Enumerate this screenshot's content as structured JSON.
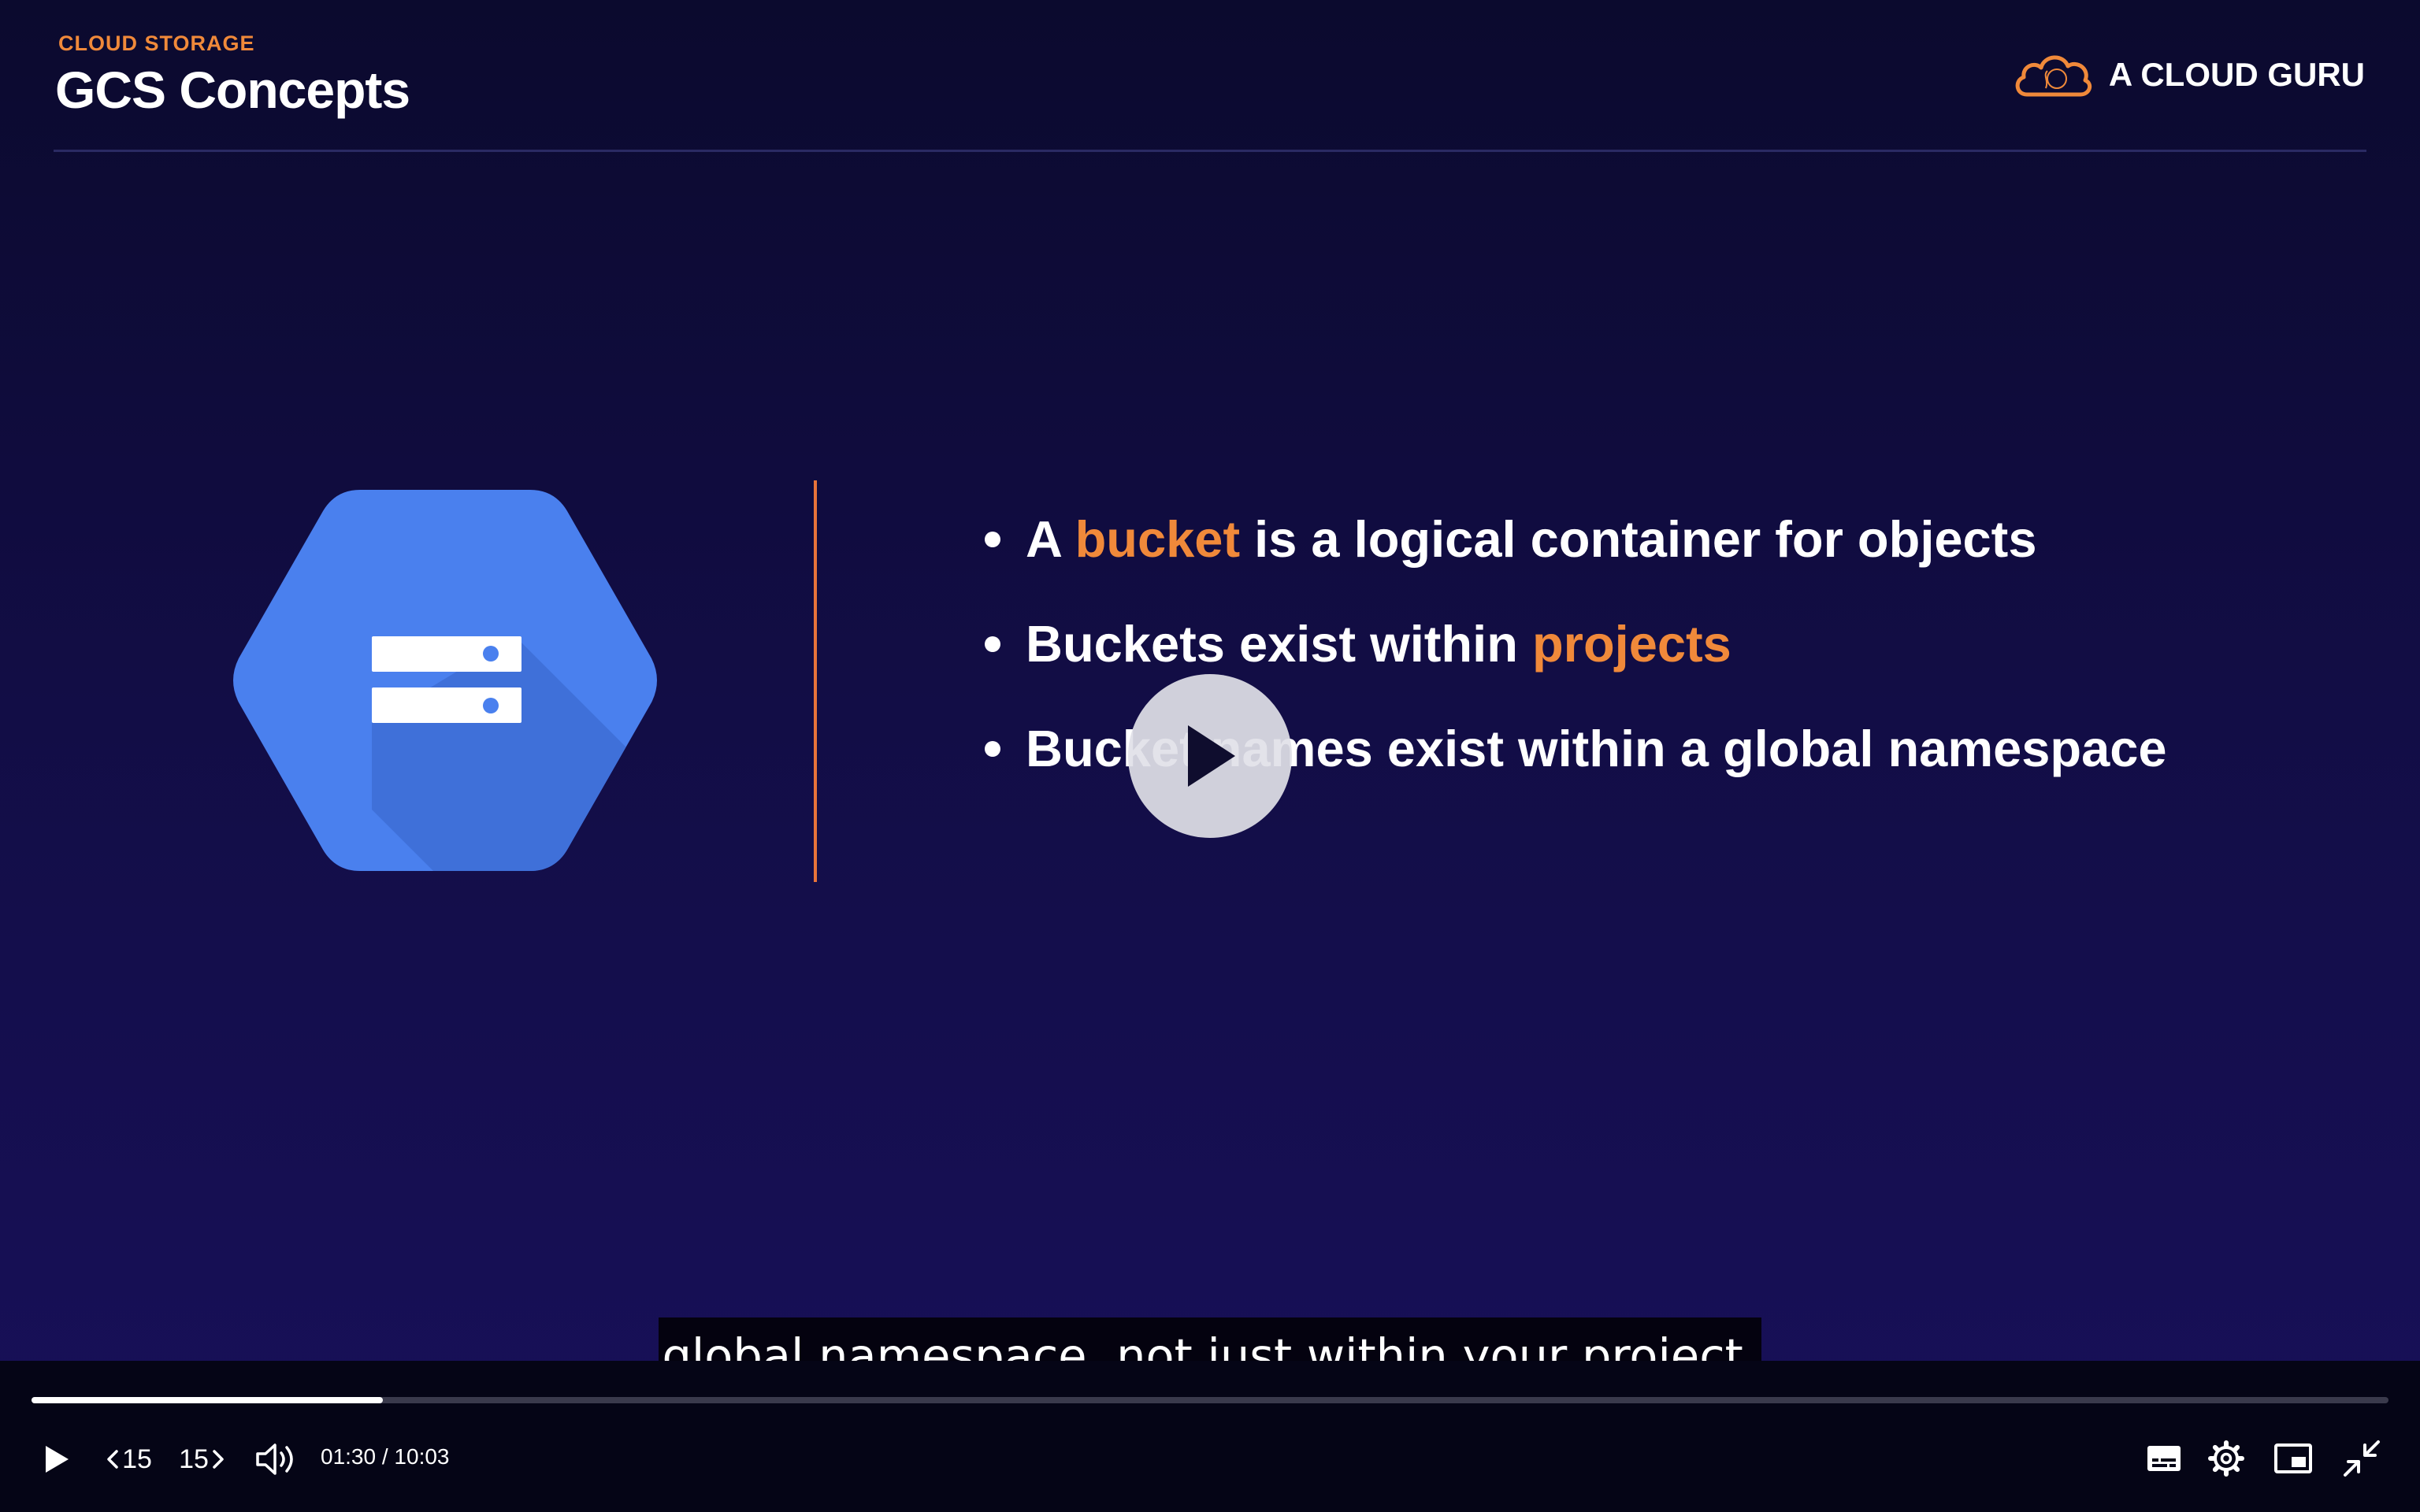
{
  "slide": {
    "kicker": "CLOUD STORAGE",
    "title": "GCS Concepts",
    "brand": {
      "text": "A CLOUD GURU",
      "icon": "cloud-logo-icon"
    },
    "logo_icon": "google-cloud-storage-icon",
    "bullets": [
      {
        "before": "A ",
        "highlight": "bucket",
        "after": " is a logical container for objects"
      },
      {
        "before": "Buckets exist within ",
        "highlight": "projects",
        "after": ""
      },
      {
        "before": "Bucket names exist within a global namespace",
        "highlight": "",
        "after": ""
      }
    ],
    "colors": {
      "accent": "#f0893a",
      "logo_blue": "#4a80ee",
      "background": "#120d45"
    }
  },
  "player": {
    "caption": "global namespace, not just within your project.",
    "current_time": "01:30",
    "separator": " / ",
    "duration": "10:03",
    "progress_fraction": 0.149,
    "skip_back_label": "15",
    "skip_forward_label": "15",
    "icons": [
      "play-icon",
      "skip-back-icon",
      "skip-forward-icon",
      "volume-icon",
      "captions-icon",
      "settings-icon",
      "picture-in-picture-icon",
      "exit-fullscreen-icon"
    ]
  }
}
